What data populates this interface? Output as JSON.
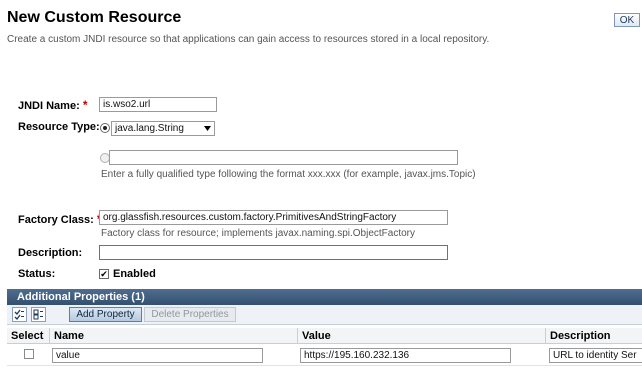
{
  "page": {
    "title": "New Custom Resource",
    "description": "Create a custom JNDI resource so that applications can gain access to resources stored in a local repository.",
    "ok_label": "OK"
  },
  "form": {
    "jndi_name": {
      "label": "JNDI Name:",
      "required_mark": "*",
      "value": "is.wso2.url"
    },
    "resource_type": {
      "label": "Resource Type:",
      "selected_option": "java.lang.String",
      "custom_type_value": "",
      "custom_type_help": "Enter a fully qualified type following the format xxx.xxx (for example, javax.jms.Topic)"
    },
    "factory_class": {
      "label": "Factory Class:",
      "required_mark": "*",
      "value": "org.glassfish.resources.custom.factory.PrimitivesAndStringFactory",
      "help": "Factory class for resource; implements javax.naming.spi.ObjectFactory"
    },
    "description": {
      "label": "Description:",
      "value": ""
    },
    "status": {
      "label": "Status:",
      "checkbox_label": "Enabled",
      "checked": true
    }
  },
  "additional_properties": {
    "header": "Additional Properties (1)",
    "add_button": "Add Property",
    "delete_button": "Delete Properties",
    "columns": [
      "Select",
      "Name",
      "Value",
      "Description"
    ],
    "rows": [
      {
        "selected": false,
        "name": "value",
        "value": "https://195.160.232.136",
        "description": "URL to identity Ser"
      }
    ]
  },
  "icons": {
    "radio_selected": "radio-selected-icon",
    "radio_unselected": "radio-unselected-icon",
    "dropdown": "chevron-down-icon",
    "select_all": "select-all-icon",
    "deselect_all": "deselect-all-icon",
    "checkmark": "checkmark-icon"
  },
  "colors": {
    "table_header_bg": "#3d5c7e",
    "required": "#c00000",
    "add_button_bg": "#c8d8ea"
  }
}
